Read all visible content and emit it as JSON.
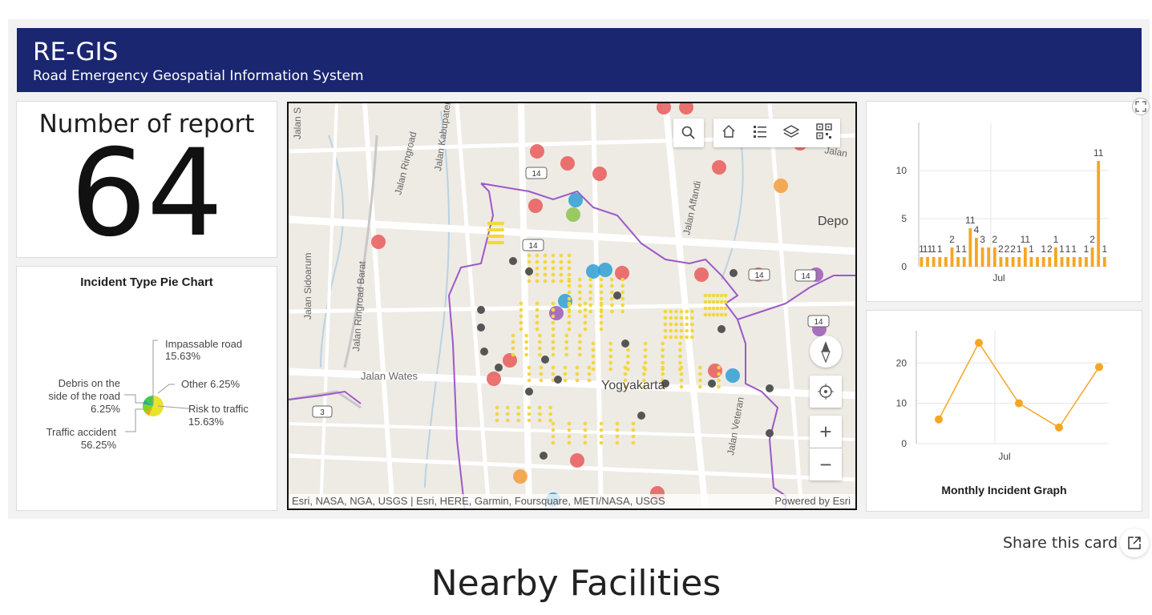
{
  "header": {
    "title": "RE-GIS",
    "subtitle": "Road Emergency Geospatial Information System"
  },
  "report_count": {
    "label": "Number of report",
    "value": "64"
  },
  "pie": {
    "title": "Incident Type Pie Chart",
    "slices": [
      {
        "label": "Traffic accident",
        "pct": "56.25%",
        "value": 56.25,
        "color": "#e8e42a"
      },
      {
        "label": "Debris on the side of the road",
        "line1": "Debris on the",
        "line2": "side of the road",
        "pct": "6.25%",
        "value": 6.25,
        "color": "#f7a21b"
      },
      {
        "label": "Impassable road",
        "pct": "15.63%",
        "value": 15.63,
        "color": "#8ad11f"
      },
      {
        "label": "Other",
        "pct": "6.25%",
        "value": 6.25,
        "color": "#2aa6a0"
      },
      {
        "label": "Risk to traffic",
        "pct": "15.63%",
        "value": 15.63,
        "color": "#44c84a"
      }
    ]
  },
  "map": {
    "attribution": "Esri, NASA, NGA, USGS | Esri, HERE, Garmin, Foursquare, METI/NASA, USGS",
    "powered_by": "Powered by Esri",
    "labels": {
      "jalan_sidoarum": "Jalan Sidoarum",
      "jalan_ringroad_barat": "Jalan Ringroad Barat",
      "jalan_wates": "Jalan Wates",
      "jalan_kabupaten": "Jalan Kabupaten",
      "jalan_ringroad": "Jalan Ringroad",
      "jalan_affandi": "Jalan Affandi",
      "jalan_veteran": "Jalan Veteran",
      "jalan_s": "Jalan S",
      "jalan_top": "Jalan",
      "depok": "Depo",
      "yogyakarta": "Yogyakarta",
      "road_14": "14",
      "road_3": "3"
    },
    "tools": {
      "search": "search-icon",
      "home": "home-icon",
      "legend": "legend-icon",
      "layers": "layers-icon",
      "qr": "qr-code-icon",
      "compass": "compass-icon",
      "locate": "locate-icon",
      "zoom_in": "+",
      "zoom_out": "−"
    }
  },
  "chart_data": [
    {
      "type": "bar",
      "title": "",
      "x_tick_labels": [
        "Jul"
      ],
      "y_ticks": [
        0,
        5,
        10
      ],
      "ylim": [
        0,
        15
      ],
      "color": "#f5a623",
      "grid": true,
      "values": [
        1,
        1,
        1,
        1,
        1,
        2,
        1,
        1,
        4,
        3,
        2,
        2,
        2,
        1,
        1,
        1,
        1,
        2,
        1,
        1,
        1,
        1,
        2,
        1,
        1,
        1,
        1,
        1,
        2,
        11,
        1
      ],
      "data_labels": [
        "1",
        "11",
        "1",
        "1",
        "2",
        "1",
        "1",
        "11",
        "4",
        "3",
        "2",
        "2",
        "2",
        "2",
        "1",
        "11",
        "1",
        "1",
        "2",
        "1",
        "1",
        "1",
        "1",
        "1",
        "2",
        "11",
        "1"
      ]
    },
    {
      "type": "line",
      "title": "Monthly Incident Graph",
      "x_tick_labels": [
        "Jul"
      ],
      "y_ticks": [
        0,
        10,
        20
      ],
      "ylim": [
        0,
        28
      ],
      "color": "#f5a623",
      "grid": true,
      "values": [
        6,
        25,
        10,
        4,
        19
      ]
    }
  ],
  "share": {
    "label": "Share this card",
    "icon": "share-icon"
  },
  "section": {
    "title": "Nearby Facilities"
  }
}
